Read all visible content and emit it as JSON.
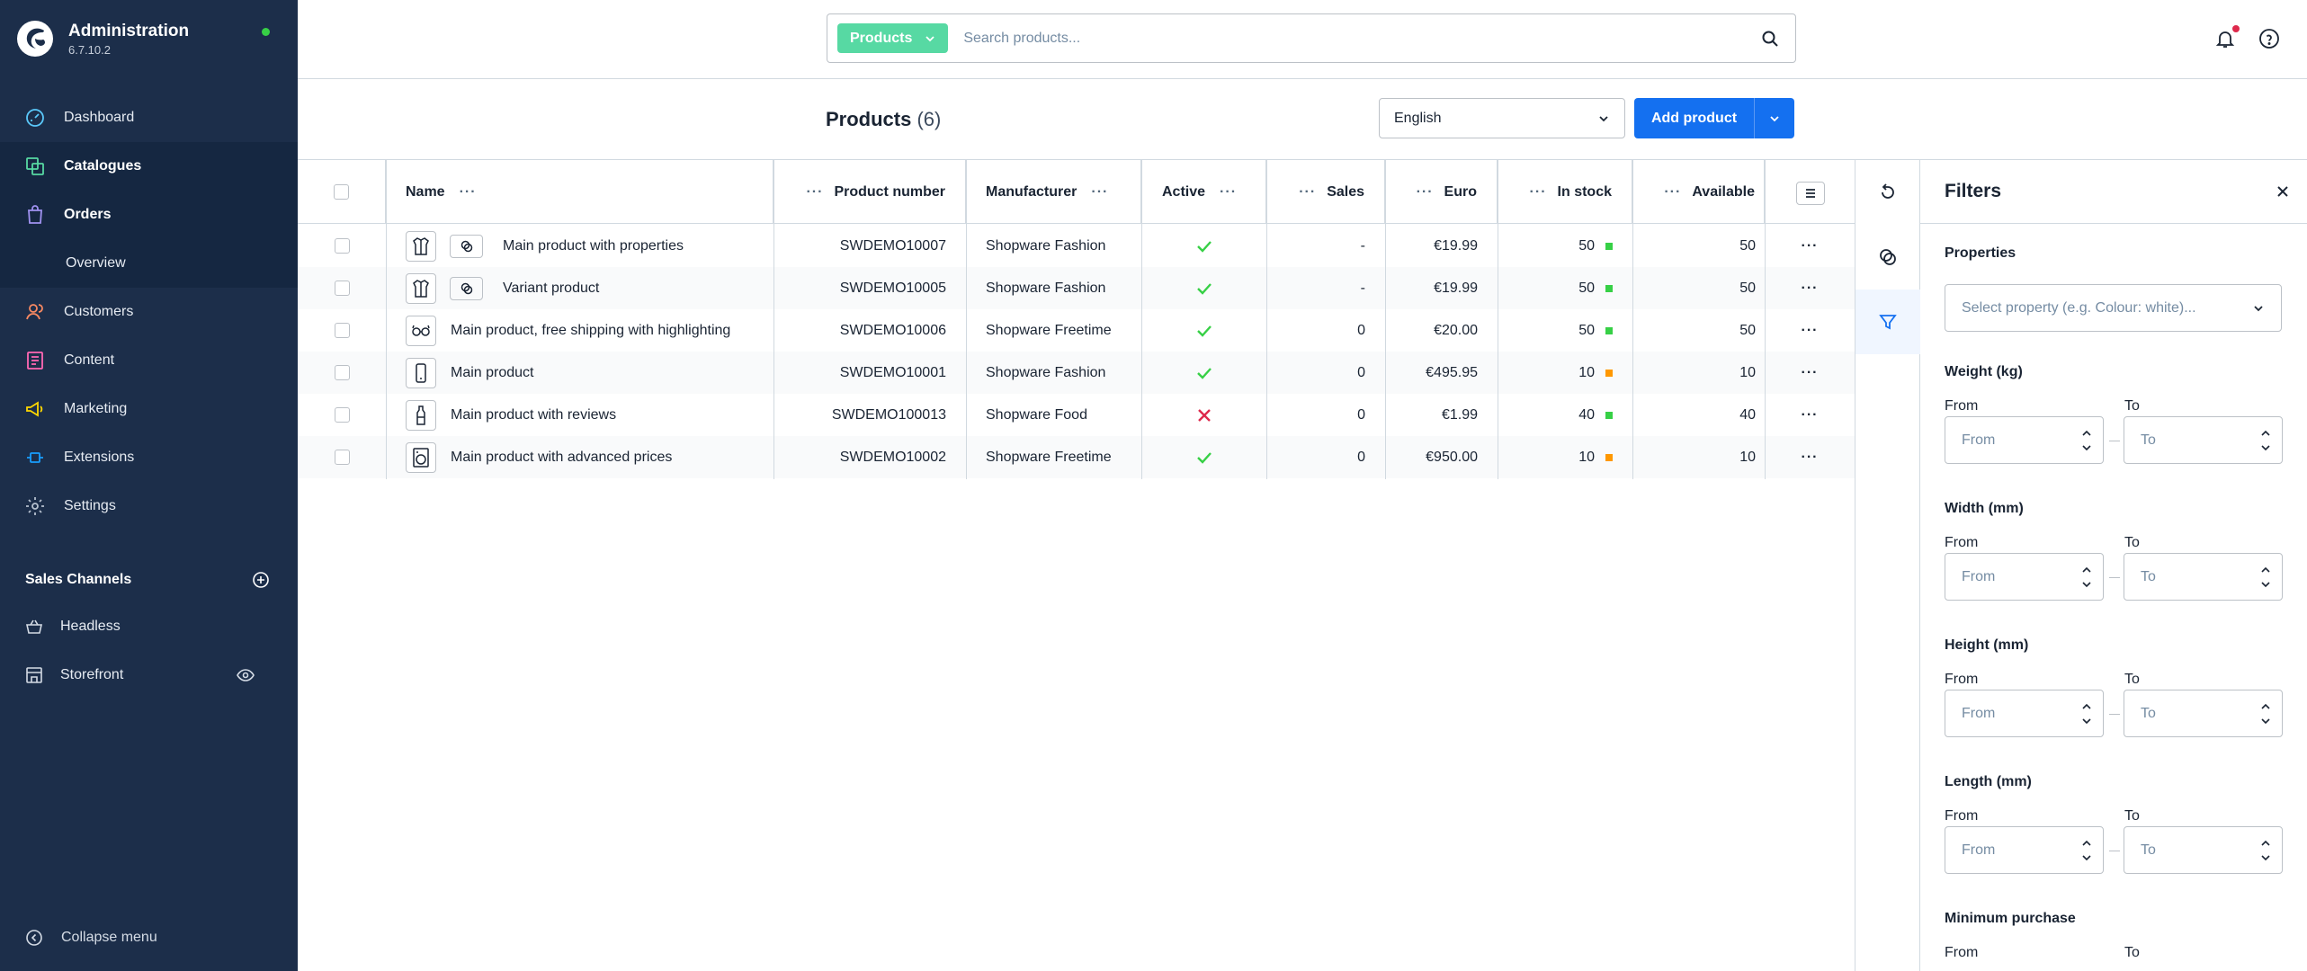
{
  "brand": {
    "title": "Administration",
    "version": "6.7.10.2"
  },
  "nav": {
    "dashboard": "Dashboard",
    "catalogues": "Catalogues",
    "orders": "Orders",
    "orders_overview": "Overview",
    "customers": "Customers",
    "content": "Content",
    "marketing": "Marketing",
    "extensions": "Extensions",
    "settings": "Settings"
  },
  "sales_channels": {
    "title": "Sales Channels",
    "items": [
      "Headless",
      "Storefront"
    ]
  },
  "collapse_label": "Collapse menu",
  "search": {
    "type_label": "Products",
    "placeholder": "Search products..."
  },
  "page": {
    "title": "Products",
    "count": "(6)"
  },
  "language": "English",
  "add_product": "Add product",
  "columns": {
    "name": "Name",
    "product_number": "Product number",
    "manufacturer": "Manufacturer",
    "active": "Active",
    "sales": "Sales",
    "price": "Euro",
    "in_stock": "In stock",
    "available": "Available"
  },
  "products": [
    {
      "name": "Main product with properties",
      "number": "SWDEMO10007",
      "manufacturer": "Shopware Fashion",
      "active": true,
      "sales": "-",
      "price": "€19.99",
      "stock": "50",
      "stock_status": "#37d046",
      "available": "50",
      "thumb": "jacket-icon",
      "variant": true
    },
    {
      "name": "Variant product",
      "number": "SWDEMO10005",
      "manufacturer": "Shopware Fashion",
      "active": true,
      "sales": "-",
      "price": "€19.99",
      "stock": "50",
      "stock_status": "#37d046",
      "available": "50",
      "thumb": "jacket-icon",
      "variant": true
    },
    {
      "name": "Main product, free shipping with highlighting",
      "number": "SWDEMO10006",
      "manufacturer": "Shopware Freetime",
      "active": true,
      "sales": "0",
      "price": "€20.00",
      "stock": "50",
      "stock_status": "#37d046",
      "available": "50",
      "thumb": "glasses-icon",
      "variant": false
    },
    {
      "name": "Main product",
      "number": "SWDEMO10001",
      "manufacturer": "Shopware Fashion",
      "active": true,
      "sales": "0",
      "price": "€495.95",
      "stock": "10",
      "stock_status": "#ff9800",
      "available": "10",
      "thumb": "phone-icon",
      "variant": false
    },
    {
      "name": "Main product with reviews",
      "number": "SWDEMO100013",
      "manufacturer": "Shopware Food",
      "active": false,
      "sales": "0",
      "price": "€1.99",
      "stock": "40",
      "stock_status": "#37d046",
      "available": "40",
      "thumb": "bottle-icon",
      "variant": false
    },
    {
      "name": "Main product with advanced prices",
      "number": "SWDEMO10002",
      "manufacturer": "Shopware Freetime",
      "active": true,
      "sales": "0",
      "price": "€950.00",
      "stock": "10",
      "stock_status": "#ff9800",
      "available": "10",
      "thumb": "washer-icon",
      "variant": false
    }
  ],
  "filters": {
    "title": "Filters",
    "properties_label": "Properties",
    "properties_placeholder": "Select property (e.g. Colour: white)...",
    "ranges": [
      {
        "label": "Weight (kg)"
      },
      {
        "label": "Width (mm)"
      },
      {
        "label": "Height (mm)"
      },
      {
        "label": "Length (mm)"
      },
      {
        "label": "Minimum purchase"
      }
    ],
    "from": "From",
    "to": "To"
  },
  "colors": {
    "sidebar": "#1c2e4a",
    "primary": "#1470f0",
    "search_tag": "#57d9a3",
    "active_check": "#37d046",
    "inactive_cross": "#de294c"
  }
}
